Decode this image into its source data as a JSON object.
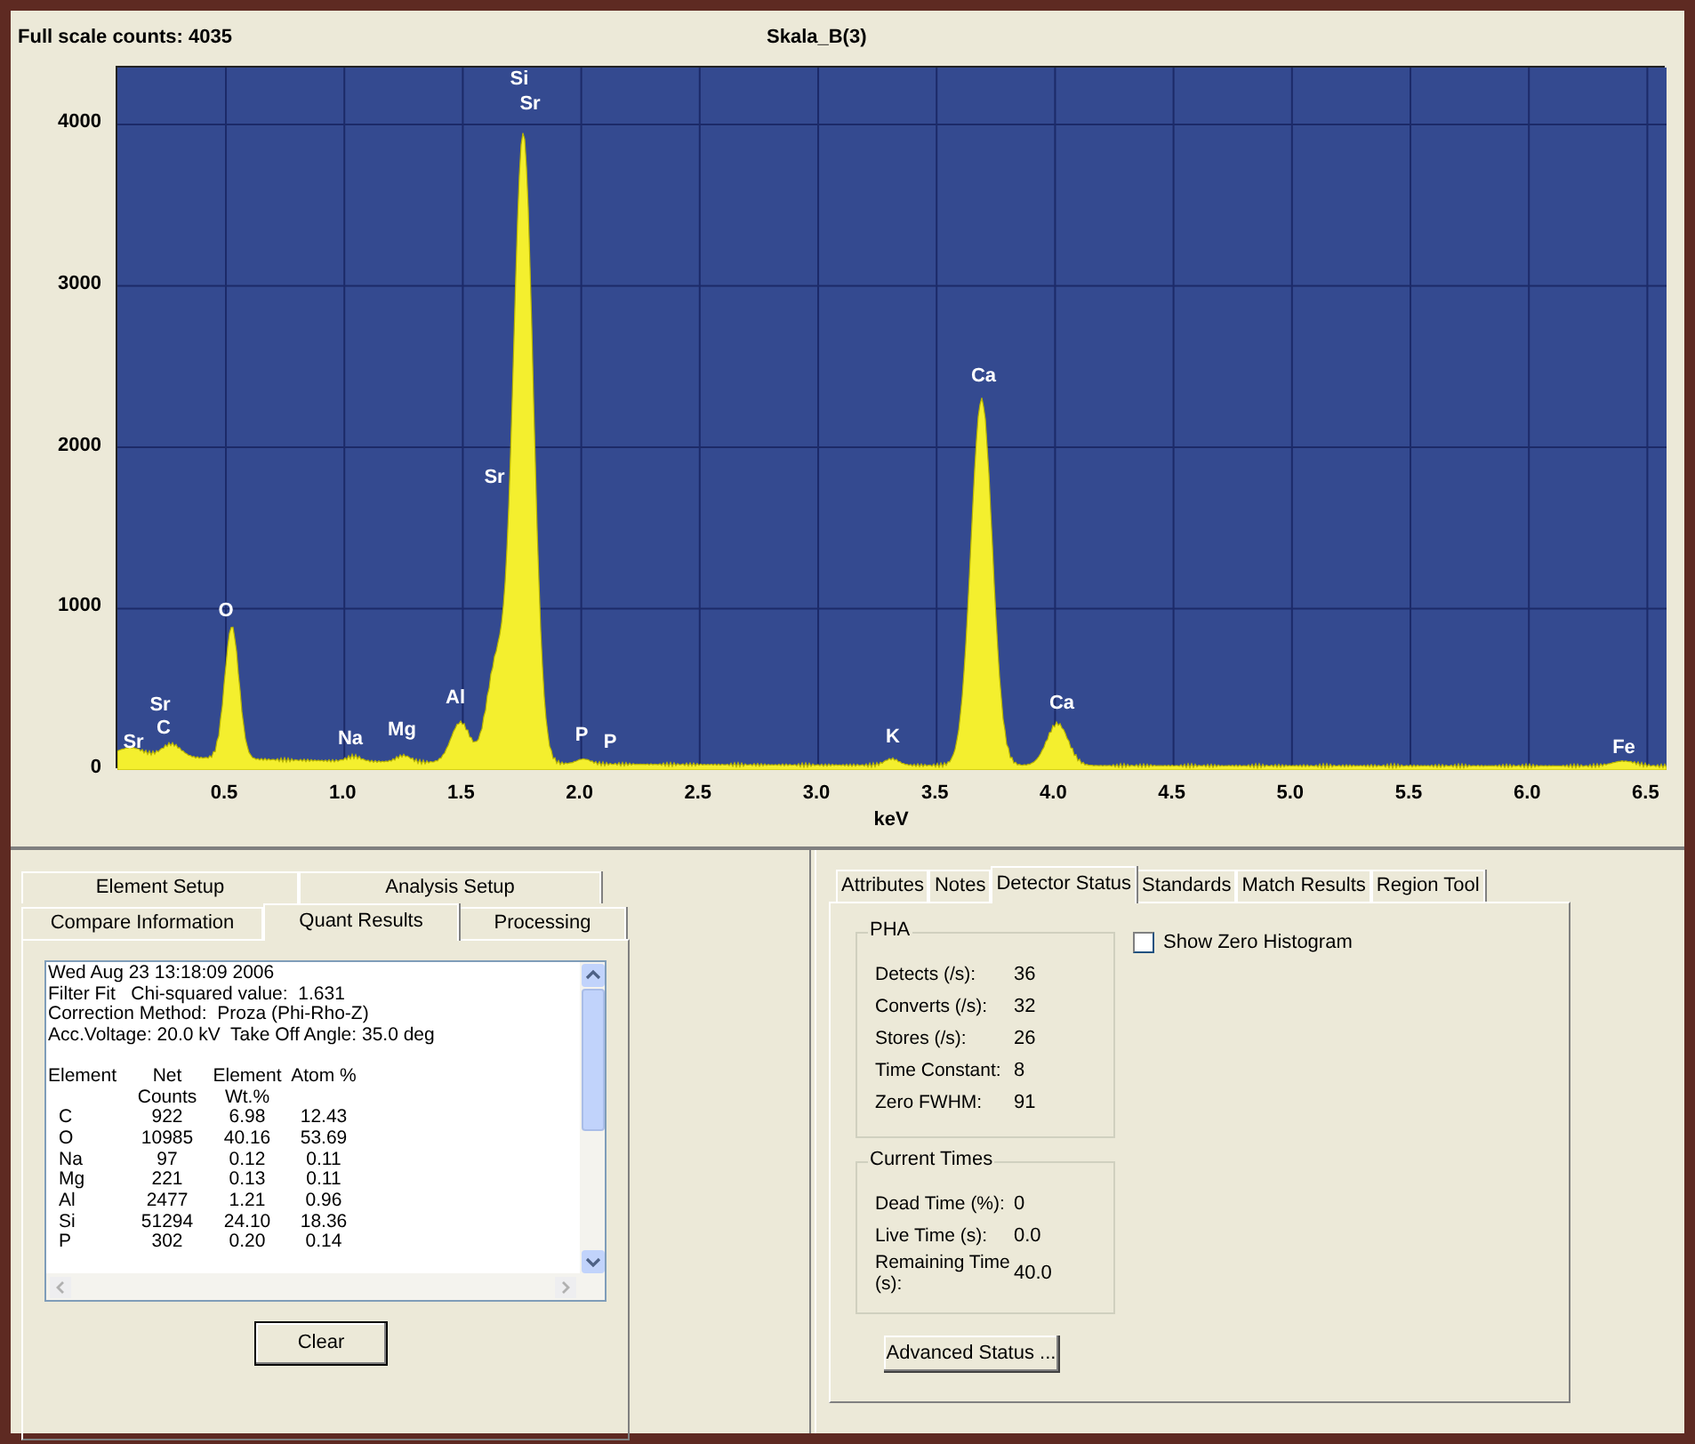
{
  "header": {
    "full_scale": "Full scale counts: 4035",
    "title": "Skala_B(3)"
  },
  "spectrum": {
    "y_ticks": [
      "4000",
      "3000",
      "2000",
      "1000",
      "0"
    ],
    "x_ticks": [
      "0.5",
      "1.0",
      "1.5",
      "2.0",
      "2.5",
      "3.0",
      "3.5",
      "4.0",
      "4.5",
      "5.0",
      "5.5",
      "6.0",
      "6.5"
    ],
    "x_axis_label": "keV",
    "peak_labels": [
      "Sr",
      "Sr",
      "C",
      "O",
      "Na",
      "Mg",
      "Al",
      "Sr",
      "Si",
      "Sr",
      "P",
      "P",
      "K",
      "Ca",
      "Ca",
      "Fe"
    ]
  },
  "left_panel": {
    "tab_rows": [
      [
        {
          "label": "Element Setup",
          "selected": false
        },
        {
          "label": "Analysis Setup",
          "selected": false
        }
      ],
      [
        {
          "label": "Compare Information",
          "selected": false
        },
        {
          "label": "Quant Results",
          "selected": true
        },
        {
          "label": "Processing",
          "selected": false
        }
      ]
    ],
    "results": {
      "header_lines": [
        "Wed Aug 23 13:18:09 2006",
        "Filter Fit   Chi-squared value:  1.631",
        "Correction Method:  Proza (Phi-Rho-Z)",
        "Acc.Voltage: 20.0 kV  Take Off Angle: 35.0 deg"
      ],
      "columns": [
        "Element",
        "Net Counts",
        "Element Wt.%",
        "Atom %"
      ],
      "rows": [
        [
          "C",
          "922",
          "6.98",
          "12.43"
        ],
        [
          "O",
          "10985",
          "40.16",
          "53.69"
        ],
        [
          "Na",
          "97",
          "0.12",
          "0.11"
        ],
        [
          "Mg",
          "221",
          "0.13",
          "0.11"
        ],
        [
          "Al",
          "2477",
          "1.21",
          "0.96"
        ],
        [
          "Si",
          "51294",
          "24.10",
          "18.36"
        ],
        [
          "P",
          "302",
          "0.20",
          "0.14"
        ]
      ]
    },
    "clear_button": "Clear"
  },
  "right_panel": {
    "tabs": [
      {
        "label": "Attributes",
        "selected": false
      },
      {
        "label": "Notes",
        "selected": false
      },
      {
        "label": "Detector Status",
        "selected": true
      },
      {
        "label": "Standards",
        "selected": false
      },
      {
        "label": "Match Results",
        "selected": false
      },
      {
        "label": "Region Tool",
        "selected": false
      }
    ],
    "pha": {
      "title": "PHA",
      "rows": [
        {
          "label": "Detects (/s):",
          "value": "36"
        },
        {
          "label": "Converts (/s):",
          "value": "32"
        },
        {
          "label": "Stores (/s):",
          "value": "26"
        },
        {
          "label": "Time Constant:",
          "value": "8"
        },
        {
          "label": "Zero FWHM:",
          "value": "91"
        }
      ]
    },
    "current_times": {
      "title": "Current Times",
      "rows": [
        {
          "label": "Dead Time (%):",
          "value": "0"
        },
        {
          "label": "Live Time (s):",
          "value": "0.0"
        },
        {
          "label": "Remaining Time (s):",
          "value": "40.0"
        }
      ]
    },
    "show_zero_histogram": {
      "label": "Show Zero Histogram",
      "checked": false
    },
    "advanced_button": "Advanced Status ..."
  }
}
